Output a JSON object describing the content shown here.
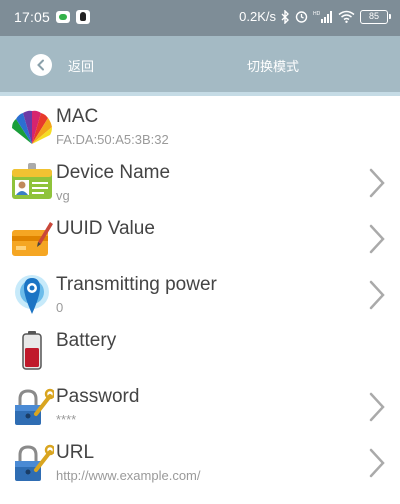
{
  "status_bar": {
    "time": "17:05",
    "speed": "0.2K/s",
    "battery": "85",
    "icons": [
      "wechat-icon",
      "qq-icon",
      "bluetooth-icon",
      "alarm-icon",
      "hd-signal-icon",
      "wifi-icon",
      "battery-icon"
    ]
  },
  "header": {
    "back_label": "返回",
    "title": "切换模式",
    "background": "#a4bac4"
  },
  "list": {
    "items": [
      {
        "label": "MAC",
        "value": "FA:DA:50:A5:3B:32",
        "icon": "color-fan-icon",
        "has_chevron": false
      },
      {
        "label": "Device Name",
        "value": "vg",
        "icon": "id-card-icon",
        "has_chevron": true
      },
      {
        "label": "UUID Value",
        "value": "",
        "icon": "card-pen-icon",
        "has_chevron": true
      },
      {
        "label": "Transmitting power",
        "value": "0",
        "icon": "signal-tag-icon",
        "has_chevron": true
      },
      {
        "label": "Battery",
        "value": "",
        "icon": "battery-level-icon",
        "has_chevron": false
      },
      {
        "label": "Password",
        "value": "****",
        "icon": "lock-key-icon",
        "has_chevron": true
      },
      {
        "label": "URL",
        "value": "http://www.example.com/",
        "icon": "lock-key-icon",
        "has_chevron": true
      }
    ]
  }
}
